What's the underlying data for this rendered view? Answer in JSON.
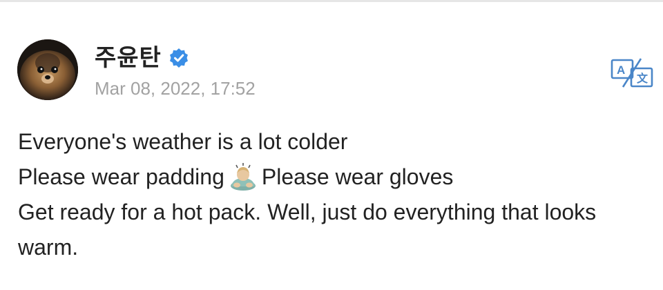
{
  "post": {
    "author_name": "주윤탄",
    "timestamp": "Mar 08, 2022, 17:52",
    "lines": {
      "l1": "Everyone's weather is a lot colder",
      "l2a": "Please wear padding",
      "l2b": "Please wear gloves",
      "l3": "Get ready for a hot pack. Well, just do everything that looks",
      "l4": "warm."
    }
  },
  "icons": {
    "avatar": "dog-avatar",
    "verified": "verified-badge-icon",
    "translate": "translate-icon",
    "emoji": "person-bowing-emoji"
  },
  "colors": {
    "verified": "#3a8ee6",
    "translate": "#4a86c8",
    "timestamp": "#a2a2a2",
    "text": "#222222"
  }
}
